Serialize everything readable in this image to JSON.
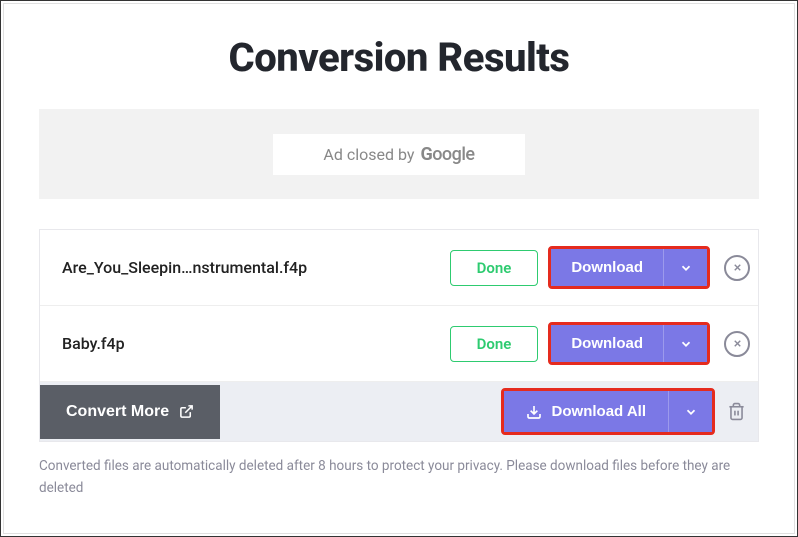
{
  "title": "Conversion Results",
  "ad": {
    "text": "Ad closed by",
    "brand": "Google"
  },
  "files": [
    {
      "name": "Are_You_Sleepin…nstrumental.f4p",
      "status": "Done",
      "download": "Download"
    },
    {
      "name": "Baby.f4p",
      "status": "Done",
      "download": "Download"
    }
  ],
  "footer": {
    "convert_more": "Convert More",
    "download_all": "Download All"
  },
  "privacy": "Converted files are automatically deleted after 8 hours to protect your privacy. Please download files before they are deleted"
}
